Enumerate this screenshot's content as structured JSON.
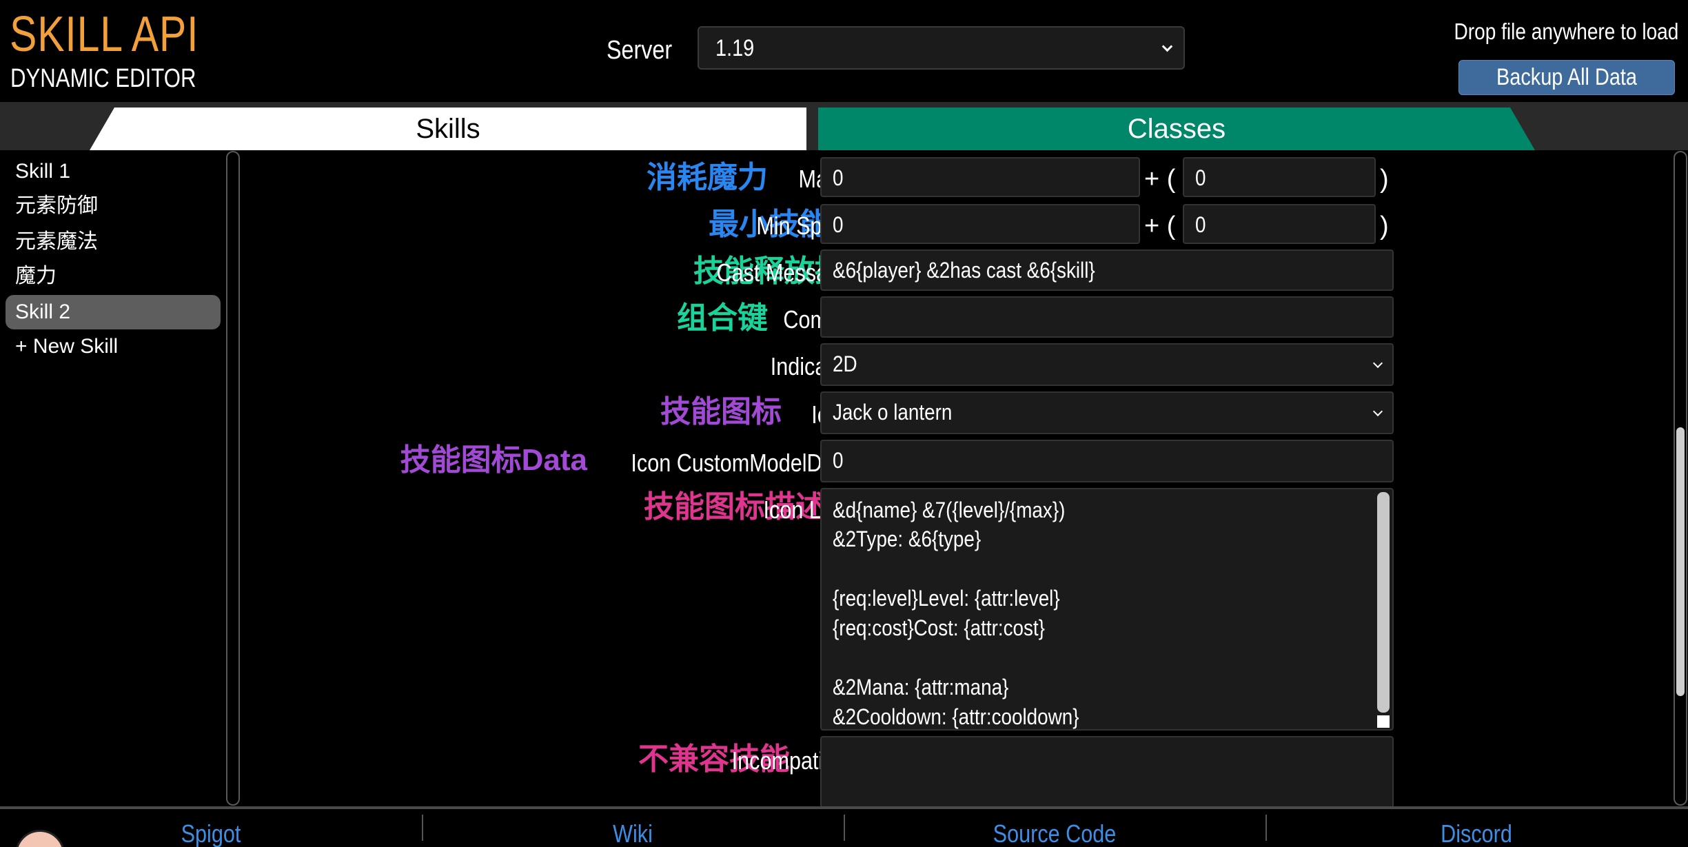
{
  "header": {
    "logo_title": "SKILL API",
    "logo_subtitle": "DYNAMIC EDITOR",
    "server_label": "Server",
    "server_value": "1.19",
    "drop_text": "Drop file anywhere to load",
    "backup_label": "Backup All Data"
  },
  "tabs": [
    {
      "label": "Skills",
      "active": true,
      "color": "#ffffff"
    },
    {
      "label": "Classes",
      "active": false,
      "color": "#00876a"
    }
  ],
  "sidebar": {
    "items": [
      {
        "label": "Skill 1"
      },
      {
        "label": "元素防御"
      },
      {
        "label": "元素魔法"
      },
      {
        "label": "魔力"
      },
      {
        "label": "Skill 2",
        "selected": true
      },
      {
        "label": "+ New Skill"
      }
    ]
  },
  "form": {
    "mana": {
      "zh": "消耗魔力",
      "en": "Mana",
      "base": "0",
      "scale": "0",
      "plus_open": "+ (",
      "close": ")"
    },
    "min_spent": {
      "zh": "最小技能点消费",
      "en": "Min Spent",
      "base": "0",
      "scale": "0",
      "plus_open": "+ (",
      "close": ")"
    },
    "cast_message": {
      "zh": "技能释放提示",
      "en": "Cast Message",
      "value": "&6{player} &2has cast &6{skill}"
    },
    "combo": {
      "zh": "组合键",
      "en": "Combo",
      "value": ""
    },
    "indicator": {
      "en": "Indicator",
      "value": "2D"
    },
    "icon": {
      "zh": "技能图标",
      "en": "Icon",
      "value": "Jack o lantern"
    },
    "icon_data": {
      "zh": "技能图标Data",
      "en": "Icon CustomModelData",
      "value": "0"
    },
    "icon_lore": {
      "zh": "技能图标描述",
      "en": "Icon Lore",
      "lines": [
        "&d{name} &7({level}/{max})",
        "&2Type: &6{type}",
        "",
        "{req:level}Level: {attr:level}",
        "{req:cost}Cost: {attr:cost}",
        "",
        "&2Mana: {attr:mana}",
        "&2Cooldown: {attr:cooldown}"
      ]
    },
    "incompatible": {
      "zh": "不兼容技能",
      "en": "Incompatible",
      "value": ""
    }
  },
  "footer": {
    "links": [
      "Spigot",
      "Wiki",
      "Source Code",
      "Discord"
    ]
  },
  "colors": {
    "accent_orange": "#f2a03c",
    "zh_blue": "#2a86f0",
    "zh_green": "#19d39a",
    "zh_purple": "#a24ad6",
    "zh_pink": "#e0358f",
    "link_blue": "#3d8fe6",
    "button_blue": "#3f6b9c"
  }
}
